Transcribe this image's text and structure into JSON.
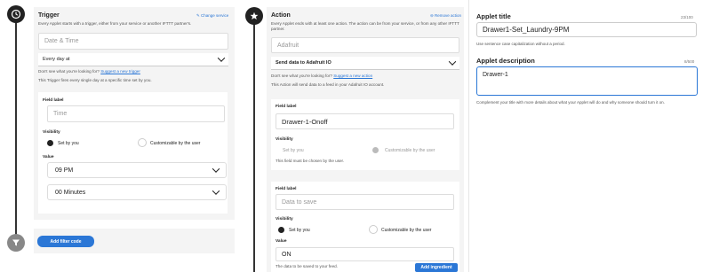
{
  "trigger": {
    "title": "Trigger",
    "change_service": "Change service",
    "description": "Every Applet starts with a trigger, either from your service or another IFTTT partner's.",
    "service_placeholder": "Date & Time",
    "trigger_select": "Every day at",
    "not_looking": "Don't see what you're looking for?",
    "suggest_link": "Suggest a new trigger",
    "fires_desc": "This Trigger fires every single day at a specific time set by you.",
    "field_label": "Field label",
    "field_value": "Time",
    "visibility_label": "Visibility",
    "set_by_you": "Set by you",
    "customizable": "Customizable by the user",
    "value_label": "Value",
    "hour": "09 PM",
    "minutes": "00 Minutes",
    "filter_button": "Add filter code"
  },
  "action": {
    "title": "Action",
    "remove_action": "Remove action",
    "description": "Every Applet ends with at least one action. The action can be from your service, or from any other IFTTT partner.",
    "service_placeholder": "Adafruit",
    "action_select": "Send data to Adafruit IO",
    "not_looking": "Don't see what you're looking for?",
    "suggest_link": "Suggest a new action",
    "action_desc": "This Action will send data to a feed in your Adafruit IO account.",
    "card1": {
      "field_label": "Field label",
      "field_value": "Drawer-1-Onoff",
      "visibility_label": "Visibility",
      "set_by_you": "Set by you",
      "customizable": "Customizable by the user",
      "note": "This field must be chosen by the user."
    },
    "card2": {
      "field_label": "Field label",
      "field_placeholder": "Data to save",
      "visibility_label": "Visibility",
      "set_by_you": "Set by you",
      "customizable": "Customizable by the user",
      "value_label": "Value",
      "value": "ON",
      "note": "The data to be saved to your feed.",
      "add_ingredient": "Add ingredient"
    }
  },
  "applet": {
    "title_label": "Applet title",
    "title_counter": "23/100",
    "title_value": "Drawer1-Set_Laundry-9PM",
    "title_help": "Use sentence case capitalization without a period.",
    "desc_label": "Applet description",
    "desc_counter": "8/500",
    "desc_value": "Drawer-1",
    "desc_help": "Complement your title with more details about what your Applet will do and why someone should turn it on."
  }
}
